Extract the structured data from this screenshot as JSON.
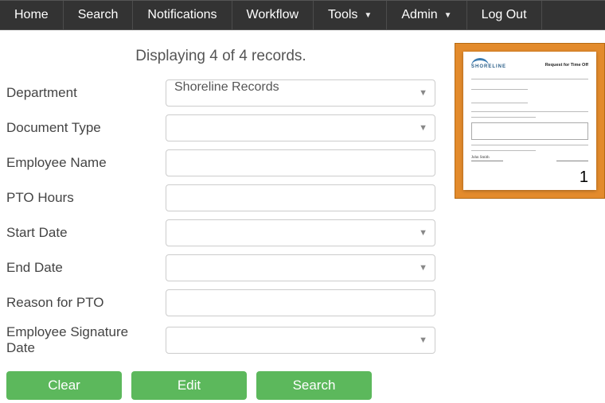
{
  "nav": {
    "home": "Home",
    "search": "Search",
    "notifications": "Notifications",
    "workflow": "Workflow",
    "tools": "Tools",
    "admin": "Admin",
    "logout": "Log Out"
  },
  "record_count_text": "Displaying 4 of 4 records.",
  "fields": {
    "department": {
      "label": "Department",
      "value": "Shoreline Records"
    },
    "document_type": {
      "label": "Document Type",
      "value": ""
    },
    "employee_name": {
      "label": "Employee Name",
      "value": ""
    },
    "pto_hours": {
      "label": "PTO Hours",
      "value": ""
    },
    "start_date": {
      "label": "Start Date",
      "value": ""
    },
    "end_date": {
      "label": "End Date",
      "value": ""
    },
    "reason": {
      "label": "Reason for PTO",
      "value": ""
    },
    "sig_date": {
      "label": "Employee Signature Date",
      "value": ""
    }
  },
  "buttons": {
    "clear": "Clear",
    "edit": "Edit",
    "search": "Search"
  },
  "preview": {
    "logo_text": "SHORELINE",
    "doc_title": "Request for Time Off",
    "signature": "John Smith",
    "page_number": "1"
  }
}
